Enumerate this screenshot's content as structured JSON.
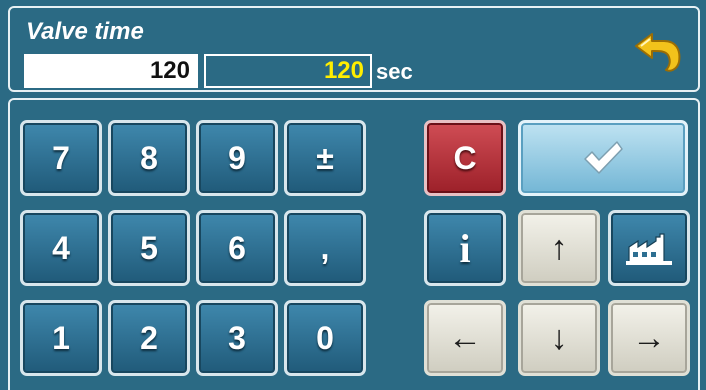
{
  "title": "Valve time",
  "current_value": "120",
  "new_value": "120",
  "unit": "sec",
  "keypad": {
    "k7": "7",
    "k8": "8",
    "k9": "9",
    "sign": "±",
    "k4": "4",
    "k5": "5",
    "k6": "6",
    "comma": ",",
    "k1": "1",
    "k2": "2",
    "k3": "3",
    "k0": "0"
  },
  "actions": {
    "clear": "C",
    "info": "i",
    "up": "↑",
    "down": "↓",
    "left": "←",
    "right": "→"
  },
  "icons": {
    "back": "back-arrow-icon",
    "confirm": "checkmark-icon",
    "factory": "factory-icon"
  },
  "colors": {
    "background": "#2b6a84",
    "key_blue": "#2f7699",
    "key_light": "#e6e4d8",
    "key_red": "#b8323b",
    "new_value_text": "#ffee00",
    "back_arrow": "#f2c21b"
  }
}
